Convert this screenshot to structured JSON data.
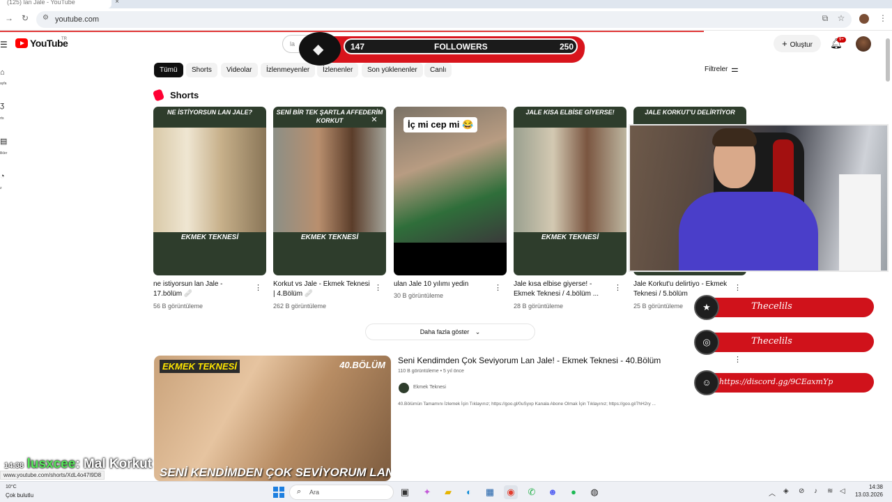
{
  "browser": {
    "tab_title": "(125) lan Jale - YouTube",
    "tab_close": "×",
    "tab_new": "+",
    "url": "youtube.com"
  },
  "youtube": {
    "logo_text": "YouTube",
    "region": "TR",
    "search_placeholder": "la",
    "create_label": "Oluştur",
    "notifications_badge": "9+",
    "sidebar": [
      {
        "icon": "home-icon",
        "label": "ayfa"
      },
      {
        "icon": "shorts-icon",
        "label": "rts"
      },
      {
        "icon": "subscriptions-icon",
        "label": "likler"
      },
      {
        "icon": "you-icon",
        "label": "z"
      }
    ],
    "chips": [
      "Tümü",
      "Shorts",
      "Videolar",
      "İzlenmeyenler",
      "İzlenenler",
      "Son yüklenenler",
      "Canlı"
    ],
    "active_chip": "Tümü",
    "filters_label": "Filtreler",
    "shorts_section_title": "Shorts",
    "shorts": [
      {
        "caption": "NE İSTİYORSUN LAN JALE?",
        "bottom": "EKMEK TEKNESİ",
        "title": "ne istiyorsun lan Jale - 17.bölüm 🩹",
        "views": "56 B görüntüleme"
      },
      {
        "caption": "SENİ BİR TEK ŞARTLA AFFEDERİM KORKUT",
        "bottom": "EKMEK TEKNESİ",
        "title": "Korkut vs Jale - Ekmek Teknesi | 4.Bölüm 🩹",
        "views": "262 B görüntüleme"
      },
      {
        "caption": "İç mi cep mi 😂",
        "bottom": "",
        "title": "ulan Jale 10 yılımı yedin",
        "views": "30 B görüntüleme"
      },
      {
        "caption": "JALE KISA ELBİSE GİYERSE!",
        "bottom": "EKMEK TEKNESİ",
        "title": "Jale kısa elbise giyerse! - Ekmek Teknesi / 4.bölüm ...",
        "views": "28 B görüntüleme"
      },
      {
        "caption": "JALE KORKUT'U DELİRTİYOR",
        "bottom": "",
        "title": "Jale Korkut'u delirtiyo - Ekmek Teknesi / 5.bölüm",
        "views": "25 B görüntüleme"
      }
    ],
    "show_more": "Daha fazla göster",
    "video": {
      "thumb_channel": "EKMEK TEKNESİ",
      "thumb_episode": "40.BÖLÜM",
      "thumb_caption": "SENİ KENDİMDEN ÇOK SEVİYORUM LAN JALE!",
      "title": "Seni Kendimden Çok Seviyorum Lan Jale! - Ekmek Teknesi - 40.Bölüm",
      "meta": "110 B görüntüleme • 5 yıl önce",
      "channel": "Ekmek Teknesi",
      "description": "40.Bölümün Tamamını İzlemek İçin Tıklayınız; https://goo.gl/0uSyxp Kanala Abone Olmak İçin Tıklayınız; https://goo.gl/7hH2ry ..."
    }
  },
  "overlay": {
    "followers_current": "147",
    "followers_label": "FOLLOWERS",
    "followers_goal": "250",
    "socials": [
      {
        "icon": "star-icon",
        "text": "Thecelils"
      },
      {
        "icon": "instagram-icon",
        "text": "Thecelils"
      },
      {
        "icon": "discord-icon",
        "text": "https://discord.gg/9CEaxmYp"
      }
    ],
    "chat": {
      "time": "14:38",
      "user": "lusxcee",
      "message": ": Mal Korkut"
    }
  },
  "status_url": "www.youtube.com/shorts/XdL4o47I9D8",
  "taskbar": {
    "weather_temp": "10°C",
    "weather_text": "Çok bulutlu",
    "search_label": "Ara",
    "time": "14:38",
    "date": "13.03.2026"
  },
  "colors": {
    "youtube_red": "#ff0000",
    "overlay_red": "#d8141c",
    "shorts_green": "#2e3d2c"
  }
}
